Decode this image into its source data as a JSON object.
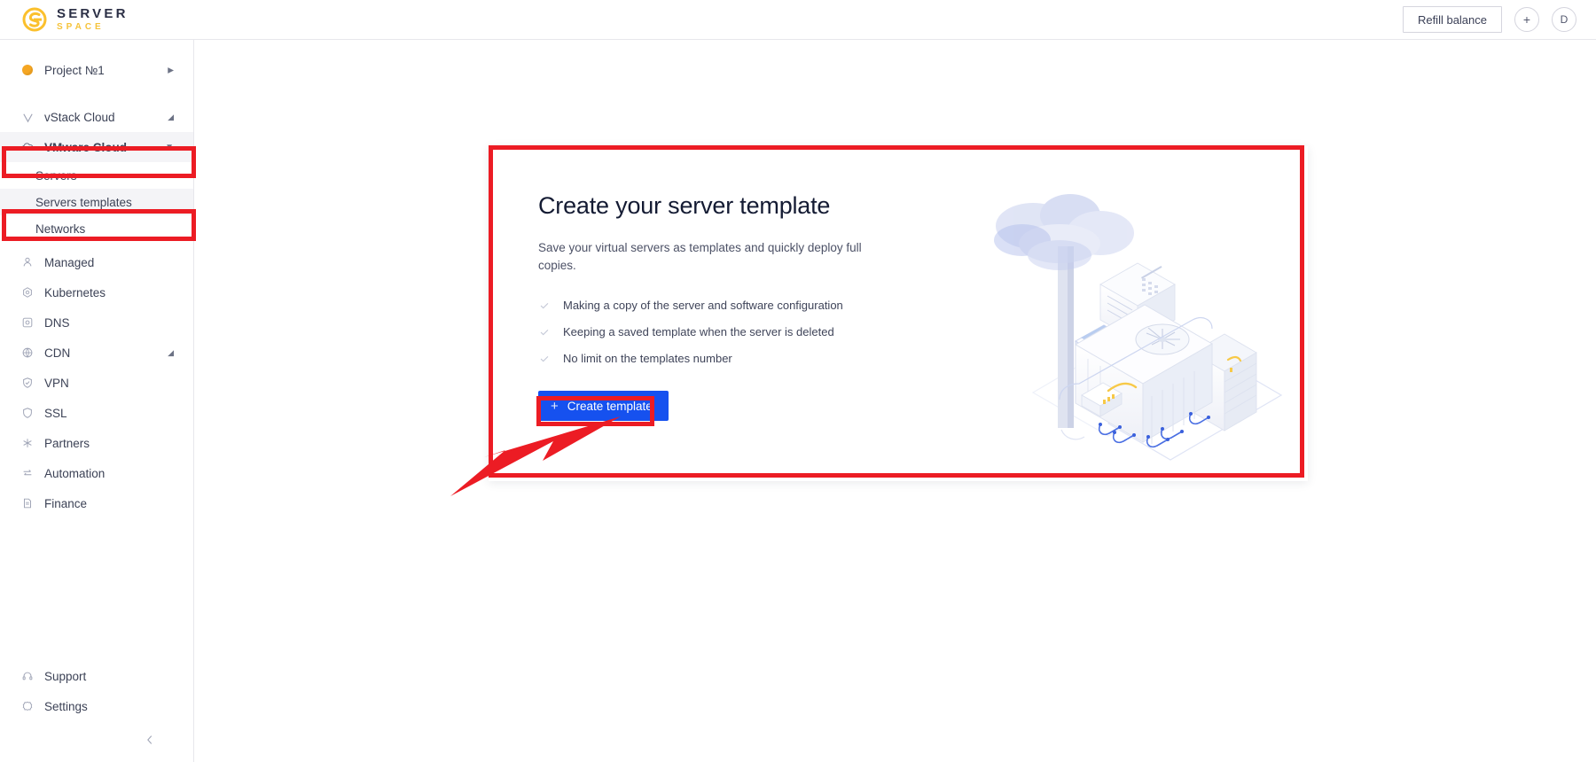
{
  "topbar": {
    "logo_top": "SERVER",
    "logo_bottom": "SPACE",
    "logo_icon": "serverspace-s-logo-icon",
    "refill_label": "Refill balance",
    "add_label": "+",
    "avatar_label": "D"
  },
  "sidebar": {
    "project": {
      "label": "Project №1",
      "icon": "project-dot-icon",
      "chevron": "▸"
    },
    "clouds": [
      {
        "label": "vStack Cloud",
        "icon": "vstack-icon",
        "tail": "◢",
        "active": false
      },
      {
        "label": "VMware Cloud",
        "icon": "cloud-icon",
        "tail": "▼",
        "active": true
      }
    ],
    "sub_items": [
      {
        "label": "Servers",
        "active": false
      },
      {
        "label": "Servers templates",
        "active": true
      },
      {
        "label": "Networks",
        "active": false
      }
    ],
    "services": [
      {
        "label": "Managed",
        "icon": "managed-user-icon",
        "tail": ""
      },
      {
        "label": "Kubernetes",
        "icon": "kubernetes-icon",
        "tail": ""
      },
      {
        "label": "DNS",
        "icon": "dns-icon",
        "tail": ""
      },
      {
        "label": "CDN",
        "icon": "cdn-globe-icon",
        "tail": "◢"
      },
      {
        "label": "VPN",
        "icon": "vpn-shield-check-icon",
        "tail": ""
      },
      {
        "label": "SSL",
        "icon": "ssl-shield-icon",
        "tail": ""
      },
      {
        "label": "Partners",
        "icon": "partners-icon",
        "tail": ""
      },
      {
        "label": "Automation",
        "icon": "automation-arrows-icon",
        "tail": ""
      },
      {
        "label": "Finance",
        "icon": "finance-doc-icon",
        "tail": ""
      }
    ],
    "footer": [
      {
        "label": "Support",
        "icon": "headset-icon"
      },
      {
        "label": "Settings",
        "icon": "gear-icon"
      }
    ],
    "collapse_icon": "chevron-left-icon"
  },
  "card": {
    "title": "Create your server template",
    "subtitle": "Save your virtual servers as templates and quickly deploy full copies.",
    "bullets": [
      "Making a copy of the server and software configuration",
      "Keeping a saved template when the server is deleted",
      "No limit on the templates number"
    ],
    "check_icon": "check-icon",
    "button_label": "Create template",
    "button_plus": "+",
    "illustration": "isometric-cloud-datacenter-illustration"
  },
  "annotations": {
    "boxes": [
      "highlight-vmware-cloud",
      "highlight-servers-templates",
      "highlight-template-card",
      "highlight-create-template-button"
    ],
    "arrow": "red-arrow-pointing-to-create-template-button"
  },
  "colors": {
    "accent_blue": "#1651ef",
    "annotation_red": "#ec1c24",
    "brand_yellow": "#f5c33b",
    "project_orange": "#f5a623",
    "sidebar_active_bg": "#f4f4f7"
  }
}
